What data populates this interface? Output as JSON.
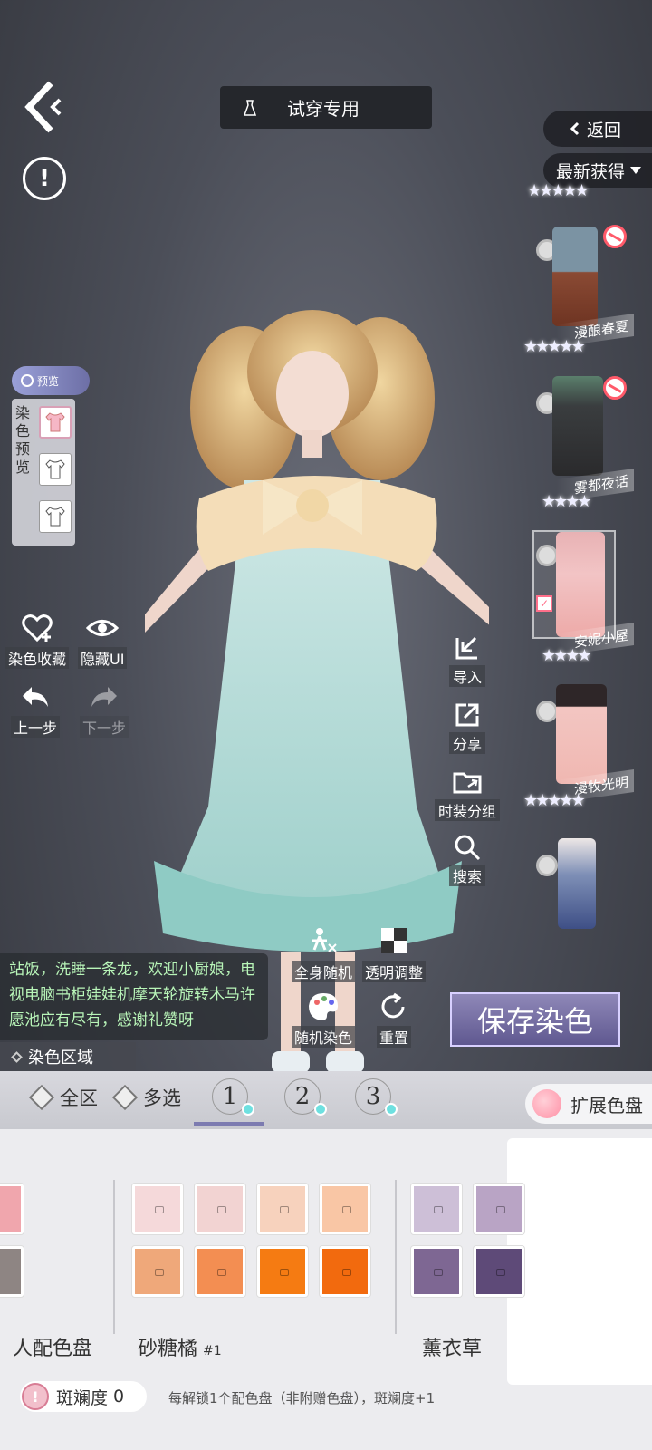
{
  "header": {
    "title": "试穿专用",
    "return_label": "返回",
    "sort_label": "最新获得"
  },
  "outfits": [
    {
      "name": "漫酿春夏",
      "stars": "★★★★★",
      "selected": false,
      "disabled": true
    },
    {
      "name": "雾都夜话",
      "stars": "★★★★★",
      "selected": false,
      "disabled": true
    },
    {
      "name": "安妮小屋",
      "stars": "★★★★",
      "selected": true,
      "disabled": false
    },
    {
      "name": "漫牧光明",
      "stars": "★★★★",
      "selected": false,
      "disabled": false
    },
    {
      "name": "",
      "stars": "★★★★★",
      "selected": false,
      "disabled": false
    }
  ],
  "left_panel": {
    "preview_tag": "预览",
    "preview_label": "染色预览",
    "dye_favorite": "染色收藏",
    "hide_ui": "隐藏UI",
    "undo": "上一步",
    "redo": "下一步"
  },
  "right_tools": {
    "import": "导入",
    "share": "分享",
    "group": "时装分组",
    "search": "搜索"
  },
  "center_tools": {
    "random_full": "全身随机",
    "transparency": "透明调整",
    "random_dye": "随机染色",
    "reset": "重置"
  },
  "chat": {
    "text": "站饭，洗睡一条龙，欢迎小厨娘，电视电脑书柜娃娃机摩天轮旋转木马许愿池应有尽有，感谢礼赞呀"
  },
  "save_button": "保存染色",
  "dye_region": {
    "label": "染色区域",
    "all": "全区",
    "multi": "多选",
    "tabs": [
      "1",
      "2",
      "3"
    ],
    "expand": "扩展色盘"
  },
  "palettes": [
    {
      "name": "人配色盘",
      "sub": "",
      "colors": [
        "#f0a6ad",
        "#8e8583"
      ]
    },
    {
      "name": "砂糖橘",
      "sub": "#1",
      "colors": [
        "#f5d9da",
        "#f2d3d2",
        "#f7d2bd",
        "#f9c6a5",
        "#efa87a",
        "#f38e52",
        "#f57b12",
        "#f26a0e"
      ]
    },
    {
      "name": "薰衣草",
      "sub": "",
      "colors": [
        "#cdbfd7",
        "#b9a4c5",
        "#7e6793",
        "#5e4a78"
      ]
    }
  ],
  "spot": {
    "label": "斑斓度",
    "value": "0",
    "tip": "每解锁1个配色盘（非附赠色盘），斑斓度+1"
  }
}
